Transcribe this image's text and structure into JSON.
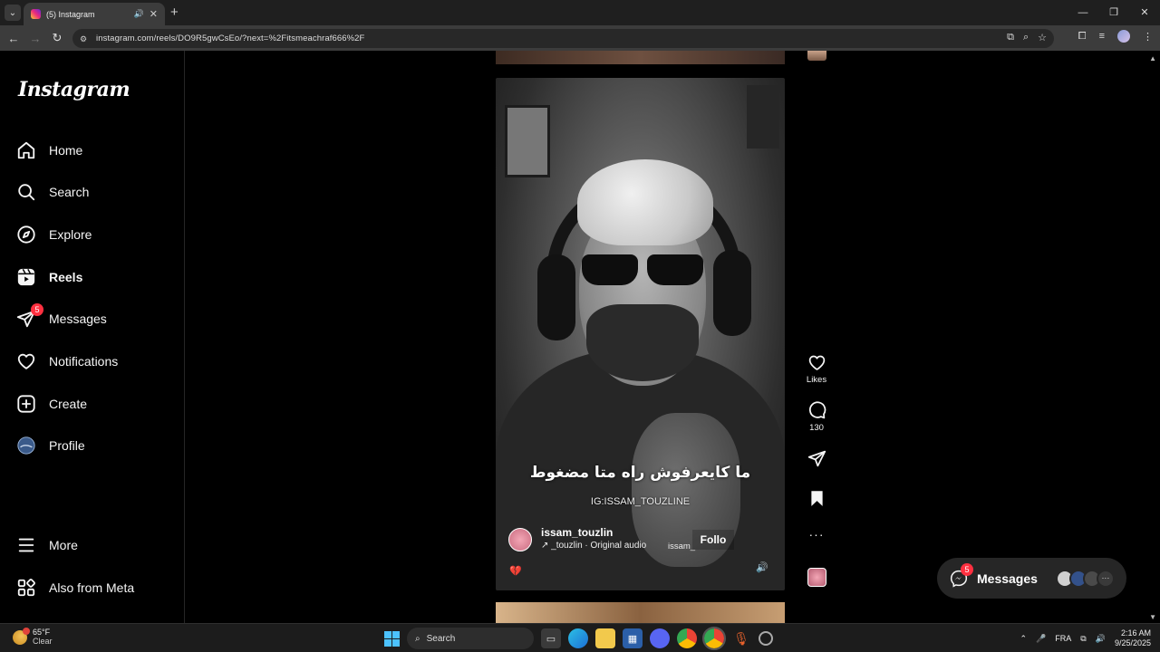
{
  "browser": {
    "tab_title": "(5) Instagram",
    "url": "instagram.com/reels/DO9R5gwCsEo/?next=%2Fitsmeachraf666%2F",
    "new_tab": "+",
    "window_controls": [
      "—",
      "❐",
      "✕"
    ]
  },
  "sidebar": {
    "logo": "Instagram",
    "items": [
      {
        "label": "Home",
        "icon": "home-icon"
      },
      {
        "label": "Search",
        "icon": "search-icon"
      },
      {
        "label": "Explore",
        "icon": "compass-icon"
      },
      {
        "label": "Reels",
        "icon": "reels-icon",
        "active": true
      },
      {
        "label": "Messages",
        "icon": "messenger-icon",
        "badge": "5"
      },
      {
        "label": "Notifications",
        "icon": "heart-icon"
      },
      {
        "label": "Create",
        "icon": "plus-square-icon"
      },
      {
        "label": "Profile",
        "icon": "profile-avatar"
      }
    ],
    "bottom_items": [
      {
        "label": "More",
        "icon": "menu-icon"
      },
      {
        "label": "Also from Meta",
        "icon": "apps-icon"
      }
    ]
  },
  "reel": {
    "caption_arabic": "ما كايعرفوش راه متا مضغوط",
    "caption_handle": "IG:ISSAM_TOUZLINE",
    "author": "issam_touzlin",
    "audio": "↗ _touzlin · Original audio",
    "audio_overflow": "issam_",
    "follow": "Follo"
  },
  "actions": {
    "likes_label": "Likes",
    "comments_count": "130",
    "more": "···"
  },
  "messages_pill": {
    "label": "Messages",
    "badge": "5",
    "more": "···"
  },
  "taskbar": {
    "temperature": "65°F",
    "condition": "Clear",
    "search_label": "Search",
    "language": "FRA",
    "time": "2:16 AM",
    "date": "9/25/2025"
  },
  "colors": {
    "badge": "#ff3040",
    "background": "#000000",
    "pill": "#262626"
  }
}
